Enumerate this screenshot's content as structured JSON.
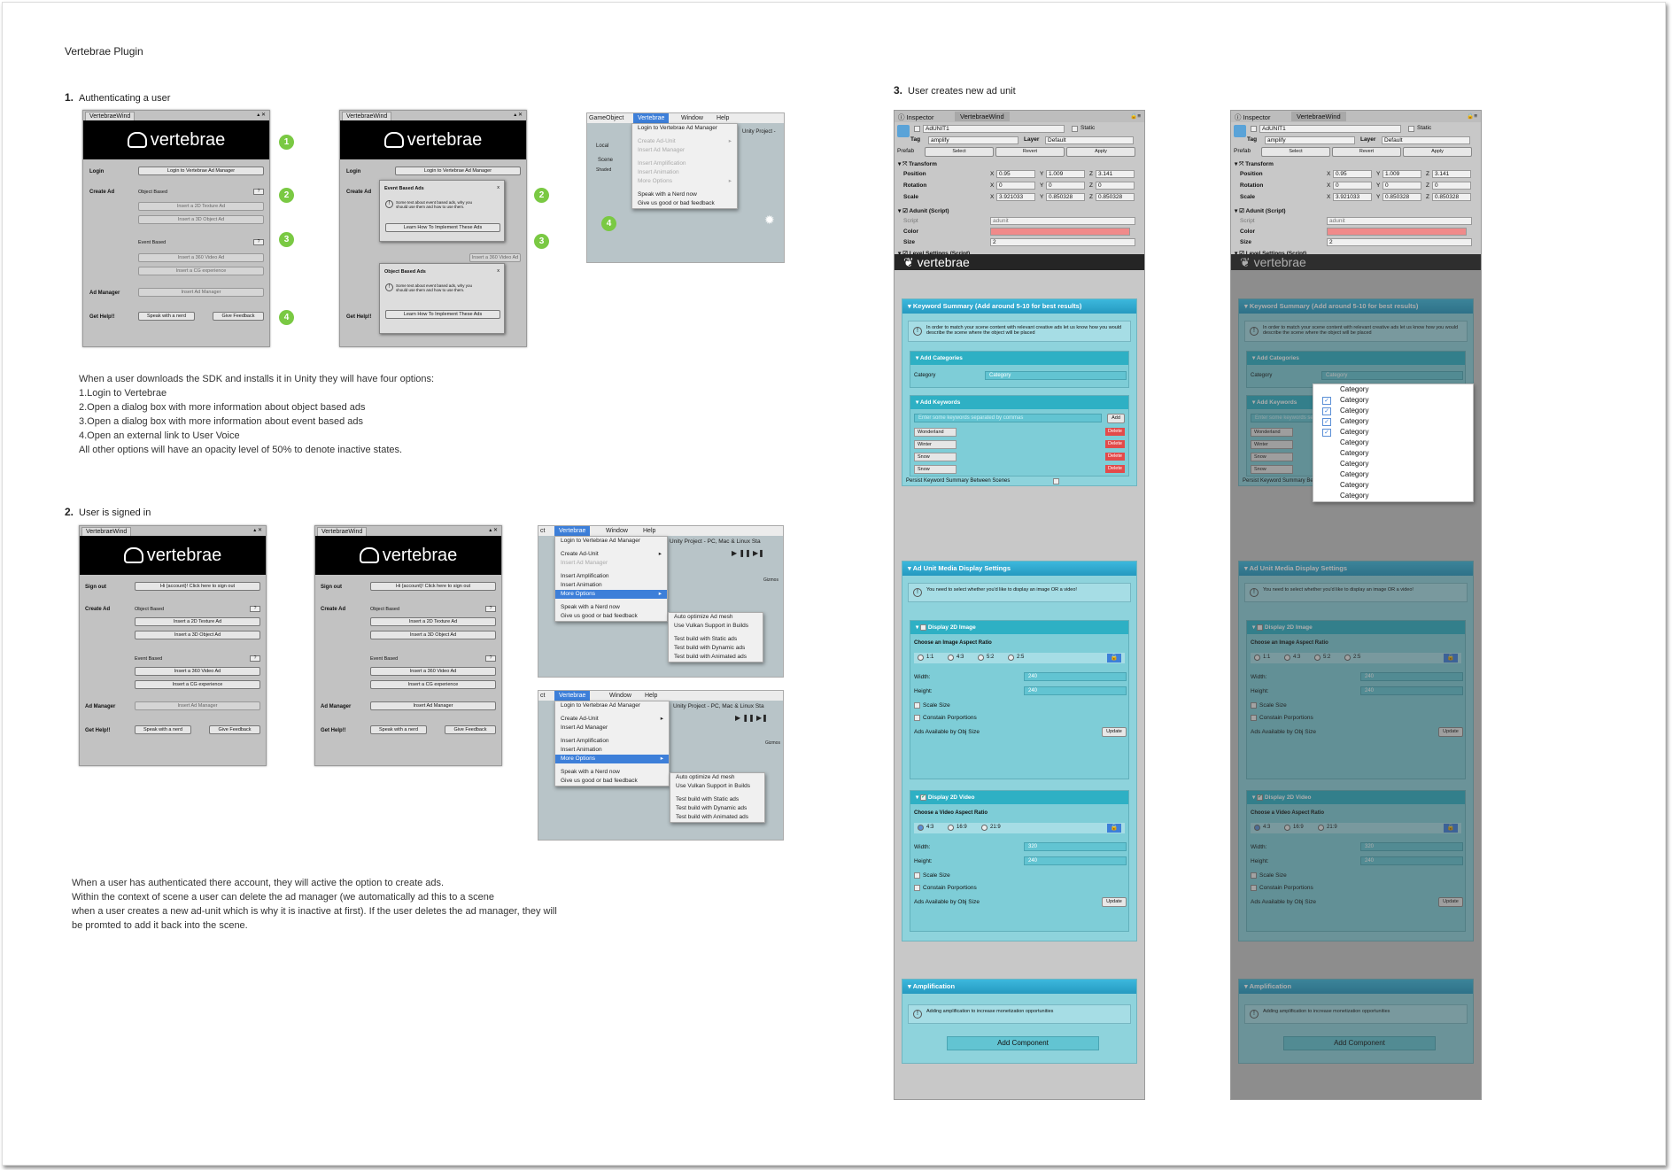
{
  "document": {
    "title": "Vertebrae Plugin",
    "sections": [
      {
        "number": "1.",
        "title": "Authenticating a user"
      },
      {
        "number": "2.",
        "title": "User is signed in"
      },
      {
        "number": "3.",
        "title": "User creates new ad unit"
      }
    ],
    "note1": [
      "When a user downloads the SDK and installs it in Unity they will have four options:",
      "1.Login to Vertebrae",
      "2.Open a dialog box with more information about object based ads",
      "3.Open a dialog box with more information about event based ads",
      "4.Open an external link to User Voice",
      "All other options will have an opacity level of 50% to denote inactive states."
    ],
    "note2": [
      "When a user has authenticated there account, they will active the option to create ads.",
      "Within the context of scene a user can delete the ad manager (we automatically ad this to a scene",
      "when a user creates a new ad-unit which is why it is inactive at first). If the user deletes the ad manager, they will",
      "be promted to add it back into the scene."
    ]
  },
  "plugin_window": {
    "tab": "VertebraeWind",
    "brand": "vertebrae",
    "login_label": "Login",
    "signout_label": "Sign out",
    "create_ad_label": "Create Ad",
    "object_based": "Object Based",
    "event_based": "Event Based",
    "ad_manager_label": "Ad Manager",
    "get_help_label": "Get Help!!",
    "help_q": "?",
    "btn_login": "Login to Vertebrae Ad Manager",
    "btn_signout": "Hi {account}!  Click here to sign out",
    "btn_2d": "Insert a 2D Texture Ad",
    "btn_3d": "Insert a 3D Object Ad",
    "btn_360": "Insert a 360 Video Ad",
    "btn_cg": "Insert a CG experience",
    "btn_adm": "Insert Ad Manager",
    "btn_nerd": "Speak with a nerd",
    "btn_feedback": "Give Feedback",
    "steps": [
      "1",
      "2",
      "3",
      "4"
    ]
  },
  "dialogs": {
    "event": {
      "title": "Event Based Ads",
      "close": "x",
      "msg": "Some text about event based ads, why you should use them and how to use them.",
      "button": "Learn How To Implement These Ads"
    },
    "object": {
      "title": "Object Based Ads",
      "close": "x",
      "msg": "Some text about event based ads, why you should use them and how to use them.",
      "button": "Learn How To Implement These Ads"
    }
  },
  "menus": {
    "bar_gameobject": "GameObject",
    "bar_vertebrae": "Vertebrae",
    "bar_window": "Window",
    "bar_help": "Help",
    "bar_ct": "ct",
    "project": "Unity Project - PC, Mac & Linux Sta",
    "project_short": "Unity Project -",
    "local": "Local",
    "scene": "Scene",
    "shaded": "Shaded",
    "gizmos": "Gizmos",
    "login": "Login to Vertebrae Ad Manager",
    "create_ad_unit": "Create Ad-Unit",
    "insert_ad_manager": "Insert Ad Manager",
    "insert_amplification": "Insert Amplification",
    "insert_animation": "Insert Animation",
    "more_options": "More Options",
    "speak_nerd": "Speak with a Nerd now",
    "feedback": "Give us good or bad feedback",
    "sub": [
      "Auto optimize Ad mesh",
      "Use Vulkan Support in Builds",
      "Test build with Static ads",
      "Test build with Dynamic ads",
      "Test build with Animated ads"
    ]
  },
  "inspector": {
    "tab_inspector": "Inspector",
    "tab_vw": "VertebraeWind",
    "object_name": "AdUNIT1",
    "static": "Static",
    "tag_label": "Tag",
    "tag_value": "amplify",
    "layer_label": "Layer",
    "layer_value": "Default",
    "prefab": "Prefab",
    "select": "Select",
    "revert": "Revert",
    "apply": "Apply",
    "transform": "Transform",
    "position": "Position",
    "rotation": "Rotation",
    "scale": "Scale",
    "pos": [
      "0.95",
      "1.009",
      "3.141"
    ],
    "rot": [
      "0",
      "0",
      "0"
    ],
    "scl": [
      "3.921033",
      "0.850328",
      "0.850328"
    ],
    "adunit_script": "Adunit (Script)",
    "script_label": "Script",
    "script_value": "adunit",
    "color_label": "Color",
    "color_value": "#f08a8a",
    "size_label": "Size",
    "size_value": "2",
    "level_settings": "Level Settings (Script)",
    "brand": "vertebrae",
    "kw_summary": "Keyword Summary (Add around 5-10 for best results)",
    "kw_info": "In order to match your scene content with relevant creative ads let us know how you would describe the scene where the object will be placed",
    "add_categories": "Add Categories",
    "category_label": "Category",
    "category_value": "Category",
    "add_keywords": "Add Keywords",
    "kw_placeholder": "Enter some keywords separated by commas",
    "add_btn": "Add",
    "keywords": [
      "Wonderland",
      "Winter",
      "Snow",
      "Snow"
    ],
    "delete": "Delete",
    "persist": "Persist Keyword Summary Between Scenes",
    "media_settings": "Ad Unit Media Display Settings",
    "media_info": "You need to select whether you'd like to display an image OR a video!",
    "display_image": "Display 2D Image",
    "image_ratio_label": "Choose an Image Aspect Ratio",
    "image_ratios": [
      "1:1",
      "4:3",
      "5:2",
      "2:5"
    ],
    "width_label": "Width:",
    "height_label": "Height:",
    "img_width": "240",
    "img_height": "240",
    "scale_size": "Scale Size",
    "constrain": "Constain Porportions",
    "ads_available": "Ads Available by Obj Size",
    "update": "Update",
    "display_video": "Display 2D Video",
    "video_ratio_label": "Choose a Video Aspect Ratio",
    "video_ratios": [
      "4:3",
      "16:9",
      "21:9"
    ],
    "vid_width": "320",
    "vid_height": "240",
    "amplification": "Amplification",
    "amp_info": "Adding amplification to increase monetization opportunities",
    "add_component": "Add Component",
    "dropdown": [
      "Category",
      "Category",
      "Category",
      "Category",
      "Category",
      "Category",
      "Category",
      "Category",
      "Category",
      "Category",
      "Category"
    ]
  },
  "colors": {
    "accent": "#2ea9cf",
    "panel": "#8ed3dc",
    "step": "#7ac943",
    "menu_highlight": "#3d7fd9",
    "delete": "#e34a4a"
  }
}
